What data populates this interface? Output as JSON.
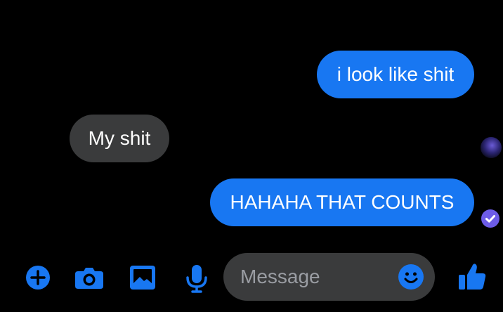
{
  "messages": [
    {
      "direction": "outgoing",
      "text": "i look like shit"
    },
    {
      "direction": "incoming",
      "text": "My shit"
    },
    {
      "direction": "outgoing",
      "text": "HAHAHA THAT COUNTS"
    }
  ],
  "composer": {
    "placeholder": "Message",
    "icons": [
      "plus-icon",
      "camera-icon",
      "gallery-icon",
      "microphone-icon",
      "emoji-icon",
      "thumbs-up-icon"
    ]
  },
  "colors": {
    "background": "#000000",
    "outgoing_bubble": "#1877f2",
    "incoming_bubble": "#3a3b3c",
    "accent": "#1877f2",
    "seen_badge": "#6d5ce7"
  }
}
